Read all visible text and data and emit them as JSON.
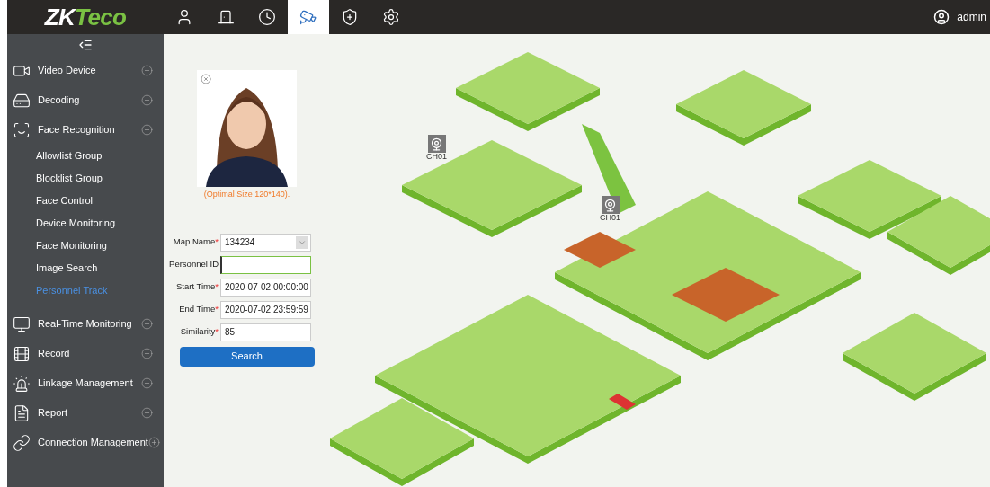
{
  "header": {
    "logo": [
      {
        "text": "ZK",
        "kind": "main"
      },
      {
        "text": "Teco",
        "kind": "accent"
      }
    ],
    "nav": [
      {
        "kind": "person",
        "selected": false
      },
      {
        "kind": "door",
        "selected": false
      },
      {
        "kind": "clock",
        "selected": false
      },
      {
        "kind": "camera",
        "selected": true
      },
      {
        "kind": "shield",
        "selected": false
      },
      {
        "kind": "gear",
        "selected": false
      }
    ],
    "user": "admin"
  },
  "sidebar": {
    "items": [
      {
        "label": "Video Device",
        "kind": "video",
        "expanded": false
      },
      {
        "label": "Decoding",
        "kind": "decoder",
        "expanded": false
      },
      {
        "label": "Face Recognition",
        "kind": "face",
        "expanded": true,
        "children": [
          {
            "label": "Allowlist Group",
            "selected": false
          },
          {
            "label": "Blocklist Group",
            "selected": false
          },
          {
            "label": "Face Control",
            "selected": false
          },
          {
            "label": "Device Monitoring",
            "selected": false
          },
          {
            "label": "Face Monitoring",
            "selected": false
          },
          {
            "label": "Image Search",
            "selected": false
          },
          {
            "label": "Personnel Track",
            "selected": true
          }
        ]
      },
      {
        "label": "Real-Time Monitoring",
        "kind": "monitor",
        "expanded": false
      },
      {
        "label": "Record",
        "kind": "record",
        "expanded": false
      },
      {
        "label": "Linkage Management",
        "kind": "alarm",
        "expanded": false
      },
      {
        "label": "Report",
        "kind": "report",
        "expanded": false
      },
      {
        "label": "Connection Management",
        "kind": "link",
        "expanded": false
      }
    ]
  },
  "form": {
    "photo_hint": "(Optimal Size 120*140).",
    "fields": [
      {
        "label": "Map Name",
        "required_mark": "*",
        "kind": "select",
        "value": "134234"
      },
      {
        "label": "Personnel ID",
        "kind": "text",
        "focused": true
      },
      {
        "label": "Start Time",
        "required_mark": "*",
        "kind": "text",
        "value": "2020-07-02 00:00:00",
        "focused": false
      },
      {
        "label": "End Time",
        "required_mark": "*",
        "kind": "text",
        "value": "2020-07-02 23:59:59",
        "focused": false
      },
      {
        "label": "Similarity",
        "required_mark": "*",
        "kind": "text",
        "value": "85",
        "focused": false
      }
    ],
    "search_button": "Search"
  },
  "map": {
    "cameras": [
      {
        "label": "CH01"
      },
      {
        "label": "CH01"
      }
    ]
  }
}
